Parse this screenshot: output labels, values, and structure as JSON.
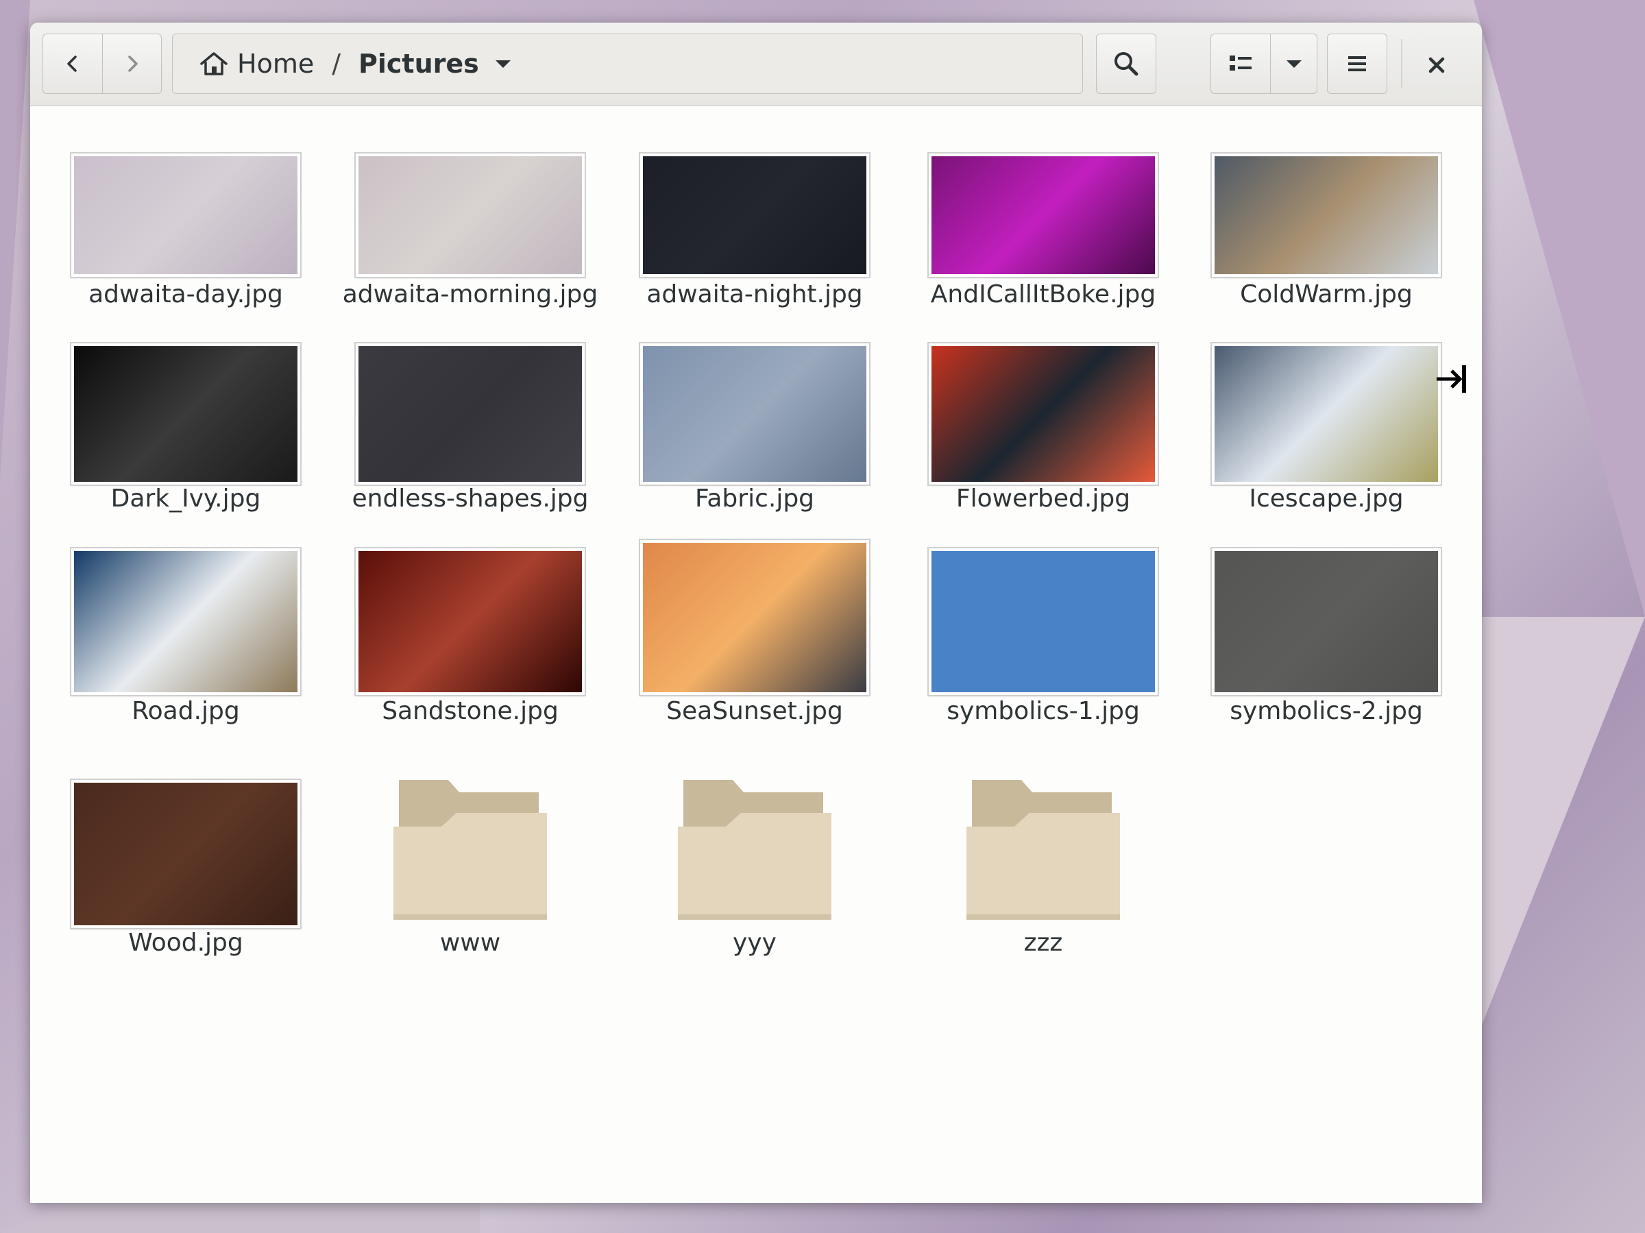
{
  "headerbar": {
    "back_icon": "chevron-left-icon",
    "forward_icon": "chevron-right-icon",
    "path": {
      "home_label": "Home",
      "separator": "/",
      "current_label": "Pictures"
    },
    "search_icon": "search-icon",
    "view_icon": "list-view-icon",
    "view_dropdown_icon": "chevron-down-icon",
    "menu_icon": "hamburger-menu-icon",
    "close_icon": "close-icon"
  },
  "items": [
    {
      "name": "adwaita-day.jpg",
      "kind": "image",
      "colors": [
        "#c9bfcc",
        "#d6cfd5",
        "#bcb1c0"
      ]
    },
    {
      "name": "adwaita-morning.jpg",
      "kind": "image",
      "colors": [
        "#cbc1c6",
        "#d8d2d0",
        "#c1b7bf"
      ]
    },
    {
      "name": "adwaita-night.jpg",
      "kind": "image",
      "colors": [
        "#1c1f28",
        "#23262f",
        "#181a22"
      ]
    },
    {
      "name": "AndICallItBoke.jpg",
      "kind": "image",
      "colors": [
        "#7a1378",
        "#c21fbe",
        "#4c0a4d"
      ]
    },
    {
      "name": "ColdWarm.jpg",
      "kind": "image",
      "colors": [
        "#4f5a66",
        "#a89070",
        "#c9d0d6"
      ]
    },
    {
      "name": "Dark_Ivy.jpg",
      "kind": "image",
      "colors": [
        "#0b0b0b",
        "#3a3a3a",
        "#1a1a1a"
      ]
    },
    {
      "name": "endless-shapes.jpg",
      "kind": "image",
      "colors": [
        "#3a3a40",
        "#333339",
        "#404046"
      ]
    },
    {
      "name": "Fabric.jpg",
      "kind": "image",
      "colors": [
        "#7f93ad",
        "#9aa9bd",
        "#66788f"
      ]
    },
    {
      "name": "Flowerbed.jpg",
      "kind": "image",
      "colors": [
        "#c8321e",
        "#1b2630",
        "#e55a3a"
      ]
    },
    {
      "name": "Icescape.jpg",
      "kind": "image",
      "colors": [
        "#4a5a70",
        "#dfe6ee",
        "#a8a060"
      ]
    },
    {
      "name": "Road.jpg",
      "kind": "image",
      "colors": [
        "#123a66",
        "#e8ecf0",
        "#8d7a5a"
      ]
    },
    {
      "name": "Sandstone.jpg",
      "kind": "image",
      "colors": [
        "#5a0f0a",
        "#a8402e",
        "#2e0604"
      ]
    },
    {
      "name": "SeaSunset.jpg",
      "kind": "image",
      "colors": [
        "#e0874a",
        "#f4b066",
        "#3a3c44"
      ]
    },
    {
      "name": "symbolics-1.jpg",
      "kind": "image",
      "colors": [
        "#4a82c8",
        "#4a82c8",
        "#4a82c8"
      ]
    },
    {
      "name": "symbolics-2.jpg",
      "kind": "image",
      "colors": [
        "#555553",
        "#5d5d5b",
        "#4f4f4d"
      ]
    },
    {
      "name": "Wood.jpg",
      "kind": "image",
      "colors": [
        "#4a2a1e",
        "#5e3726",
        "#3b2016"
      ]
    },
    {
      "name": "www",
      "kind": "folder"
    },
    {
      "name": "yyy",
      "kind": "folder"
    },
    {
      "name": "zzz",
      "kind": "folder"
    }
  ],
  "folder_colors": {
    "back": "#c8b99a",
    "front": "#e4d6bc",
    "tab": "#bcad8f"
  },
  "cursor_icon": "resize-right-cursor-icon"
}
